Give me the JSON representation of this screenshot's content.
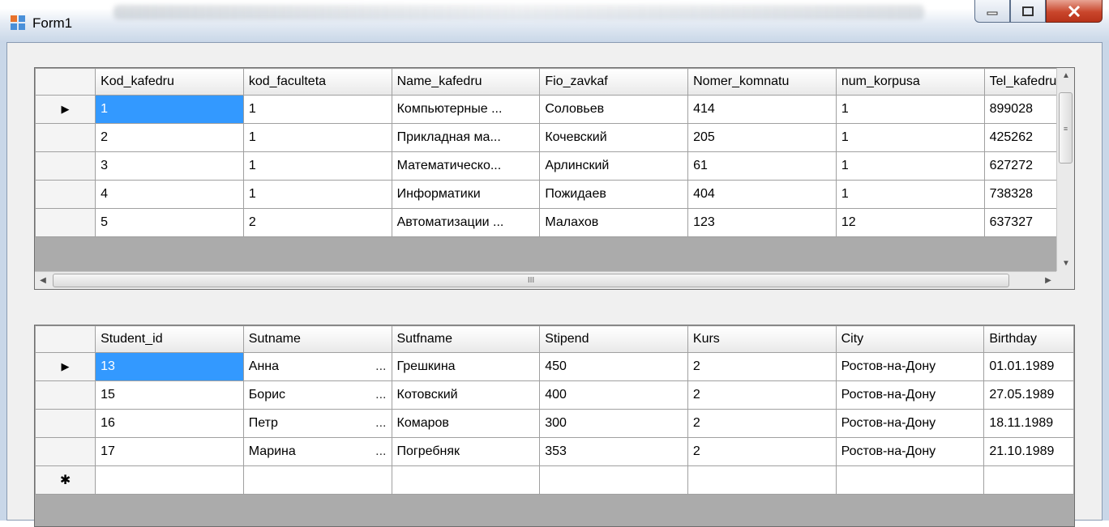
{
  "window": {
    "title": "Form1"
  },
  "grid1": {
    "columns": [
      "Kod_kafedru",
      "kod_faculteta",
      "Name_kafedru",
      "Fio_zavkaf",
      "Nomer_komnatu",
      "num_korpusa",
      "Tel_kafedru"
    ],
    "rows": [
      [
        "1",
        "1",
        "Компьютерные ...",
        "Соловьев",
        "414",
        "1",
        "899028"
      ],
      [
        "2",
        "1",
        "Прикладная ма...",
        "Кочевский",
        "205",
        "1",
        "425262"
      ],
      [
        "3",
        "1",
        "Математическо...",
        "Арлинский",
        "61",
        "1",
        "627272"
      ],
      [
        "4",
        "1",
        "Информатики",
        "Пожидаев",
        "404",
        "1",
        "738328"
      ],
      [
        "5",
        "2",
        "Автоматизации ...",
        "Малахов",
        "123",
        "12",
        "637327"
      ]
    ],
    "current_row_marker": "▶",
    "hscroll_grip": "III",
    "vscroll_grip": "≡"
  },
  "grid2": {
    "columns": [
      "Student_id",
      "Sutname",
      "Sutfname",
      "Stipend",
      "Kurs",
      "City",
      "Birthday"
    ],
    "rows": [
      [
        "13",
        "Анна",
        "Грешкина",
        "450",
        "2",
        "Ростов-на-Дону",
        "01.01.1989"
      ],
      [
        "15",
        "Борис",
        "Котовский",
        "400",
        "2",
        "Ростов-на-Дону",
        "27.05.1989"
      ],
      [
        "16",
        "Петр",
        "Комаров",
        "300",
        "2",
        "Ростов-на-Дону",
        "18.11.1989"
      ],
      [
        "17",
        "Марина",
        "Погребняк",
        "353",
        "2",
        "Ростов-на-Дону",
        "21.10.1989"
      ]
    ],
    "ellipsis": "...",
    "current_row_marker": "▶",
    "new_row_marker": "✱"
  }
}
